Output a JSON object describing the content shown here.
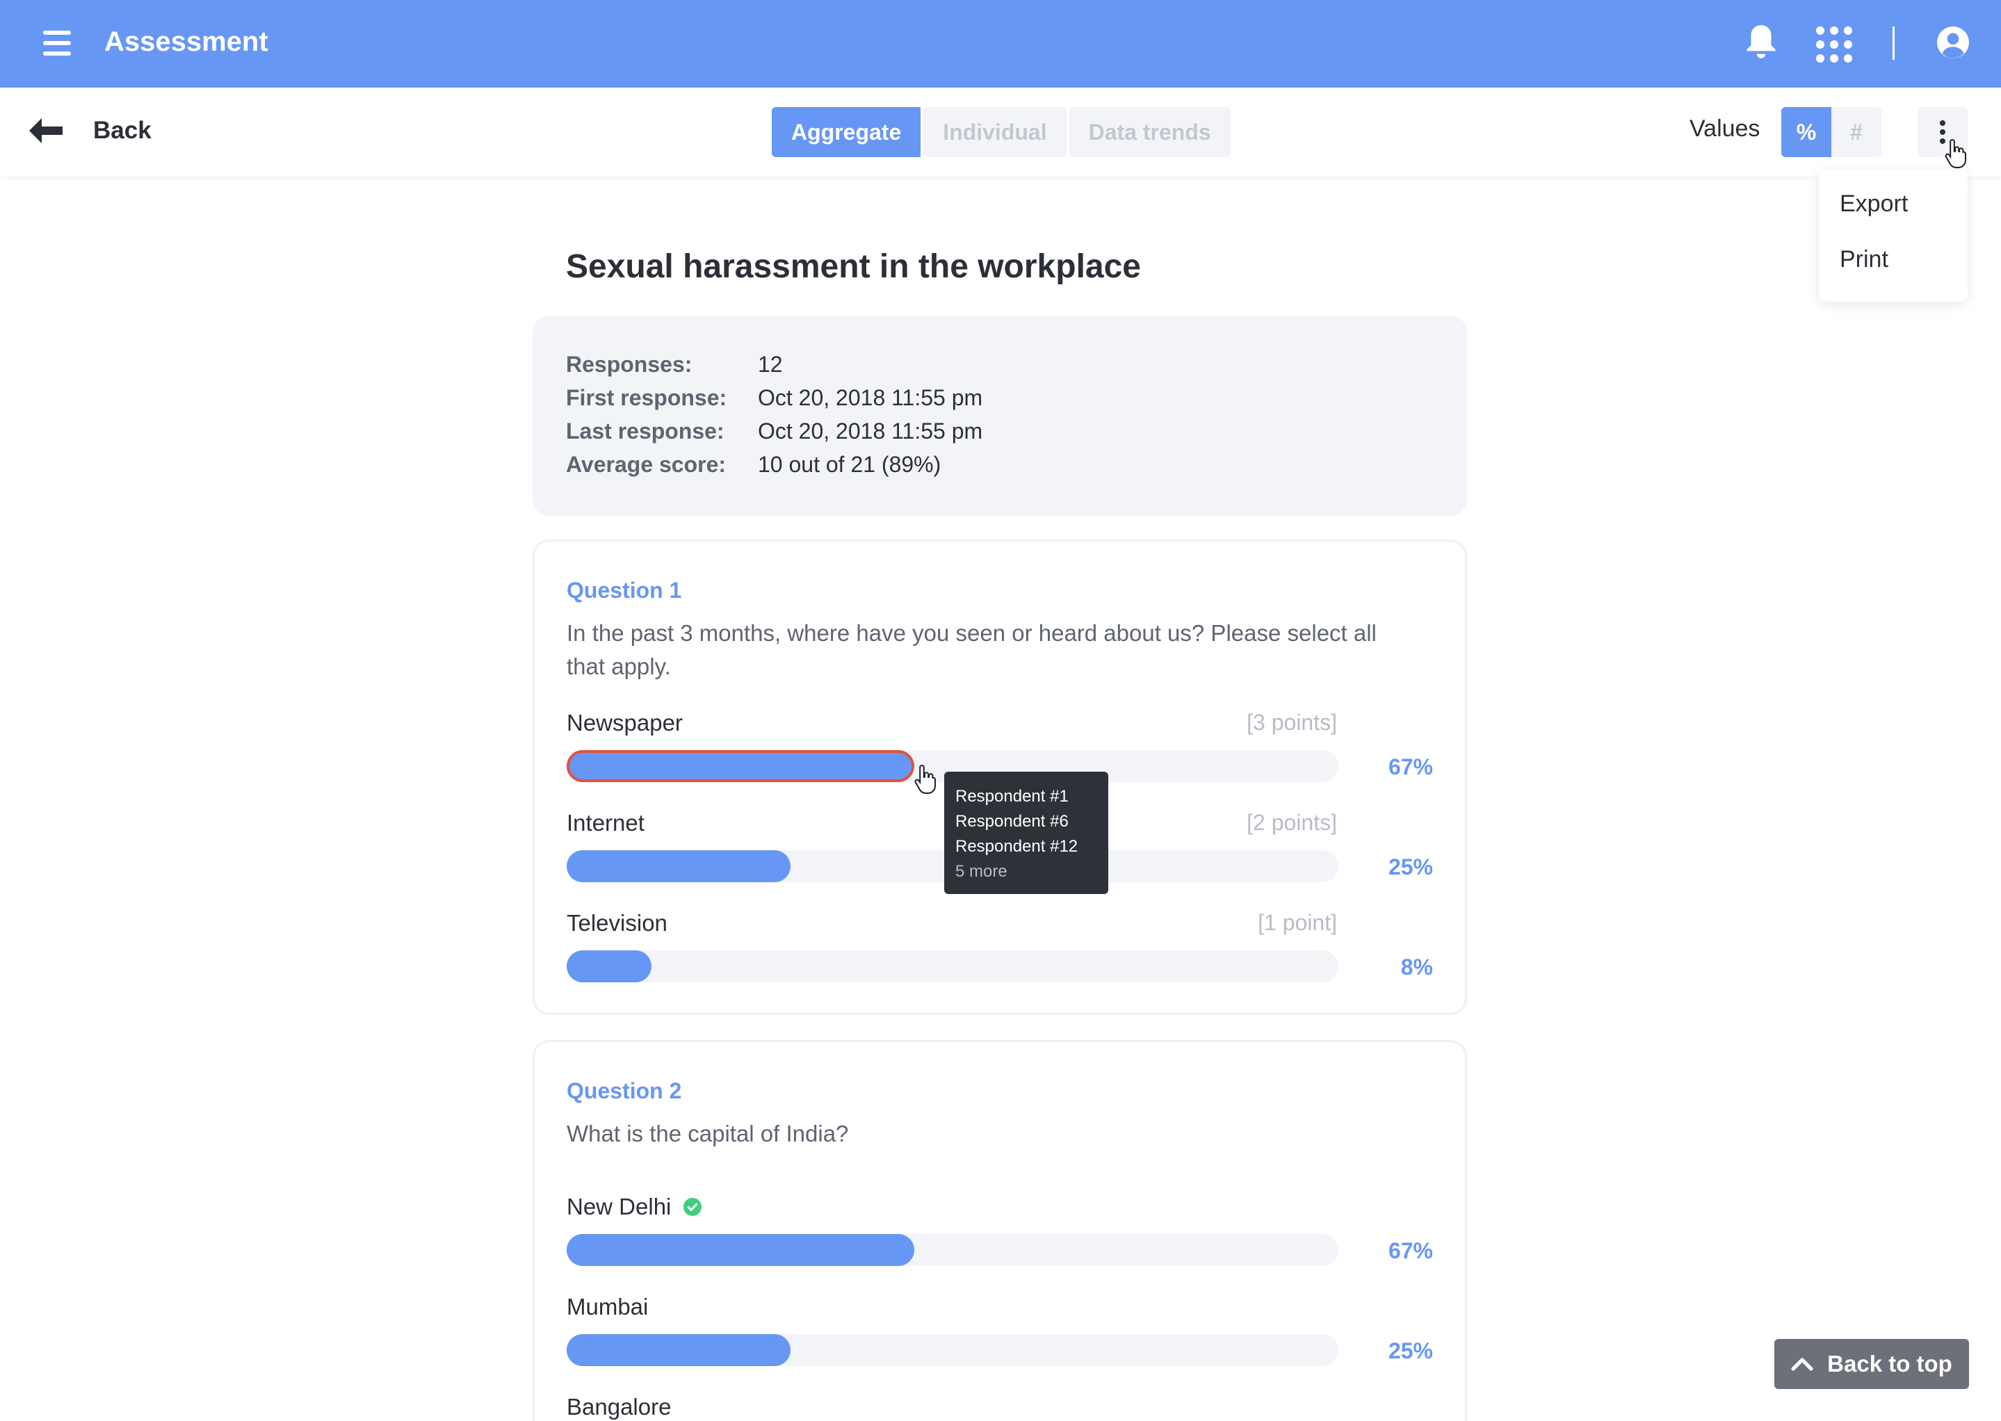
{
  "app": {
    "title": "Assessment"
  },
  "toolbar": {
    "back_label": "Back",
    "tabs": [
      {
        "label": "Aggregate",
        "active": true
      },
      {
        "label": "Individual",
        "active": false
      },
      {
        "label": "Data trends",
        "active": false
      }
    ],
    "values_label": "Values",
    "value_modes": [
      {
        "label": "%",
        "active": true
      },
      {
        "label": "#",
        "active": false
      }
    ]
  },
  "menu": {
    "items": [
      "Export",
      "Print"
    ]
  },
  "page": {
    "title": "Sexual harassment in the workplace"
  },
  "summary": [
    {
      "key": "Responses:",
      "value": "12"
    },
    {
      "key": "First response:",
      "value": "Oct 20, 2018 11:55 pm"
    },
    {
      "key": "Last response:",
      "value": "Oct 20, 2018 11:55 pm"
    },
    {
      "key": "Average score:",
      "value": "10 out of 21 (89%)"
    }
  ],
  "questions": [
    {
      "label": "Question 1",
      "text": "In the past 3 months, where have you seen or heard about us? Please select all that apply.",
      "options": [
        {
          "label": "Newspaper",
          "points": "[3 points]",
          "percent_label": "67%",
          "fraction": 0.45
        },
        {
          "label": "Internet",
          "points": "[2 points]",
          "percent_label": "25%",
          "fraction": 0.29
        },
        {
          "label": "Television",
          "points": "[1 point]",
          "percent_label": "8%",
          "fraction": 0.11
        }
      ]
    },
    {
      "label": "Question 2",
      "text": "What is the capital of India?",
      "options": [
        {
          "label": "New Delhi",
          "correct": true,
          "percent_label": "67%",
          "fraction": 0.45
        },
        {
          "label": "Mumbai",
          "percent_label": "25%",
          "fraction": 0.29
        },
        {
          "label": "Bangalore"
        }
      ]
    }
  ],
  "tooltip": {
    "lines": [
      "Respondent #1",
      "Respondent #6",
      "Respondent #12"
    ],
    "more": "5 more"
  },
  "back_to_top": "Back to top",
  "colors": {
    "accent": "#6797f4",
    "hover_border": "#e0533f",
    "correct": "#3fcf7a"
  }
}
